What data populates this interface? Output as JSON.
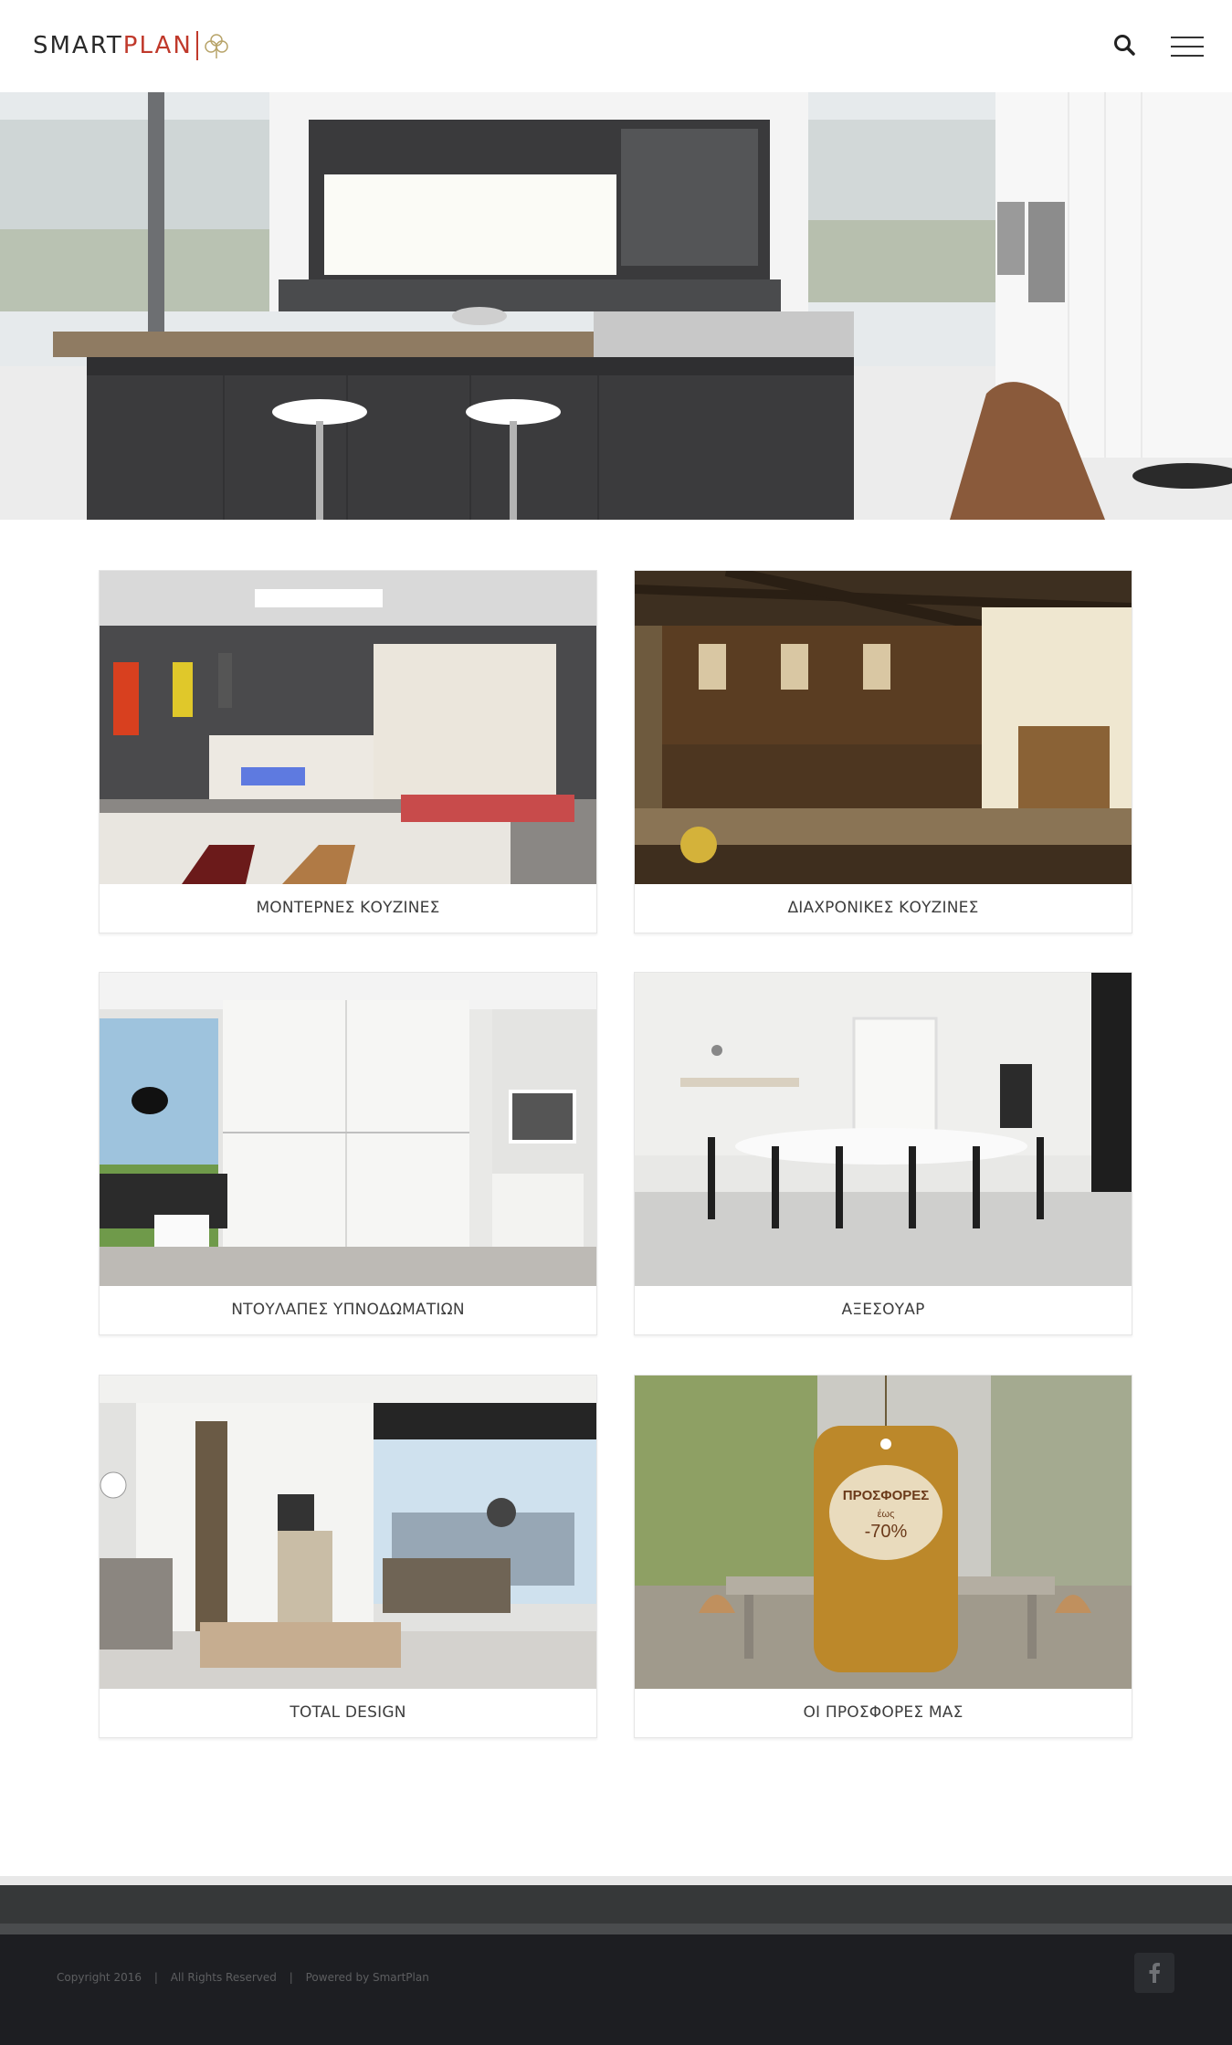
{
  "header": {
    "logo_smart": "SMART",
    "logo_plan": "PLAN",
    "search_icon": "search-icon",
    "menu_icon": "hamburger-menu-icon"
  },
  "hero": {
    "slides": 3,
    "active_slide": 2
  },
  "categories": [
    {
      "label": "ΜΟΝΤΕΡΝΕΣ ΚΟΥΖΙΝΕΣ"
    },
    {
      "label": "ΔΙΑΧΡΟΝΙΚΕΣ ΚΟΥΖΙΝΕΣ"
    },
    {
      "label": "ΝΤΟΥΛΑΠΕΣ ΥΠΝΟΔΩΜΑΤΙΩΝ"
    },
    {
      "label": "ΑΞΕΣΟΥΑΡ"
    },
    {
      "label": "TOTAL DESIGN"
    },
    {
      "label": "ΟΙ ΠΡΟΣΦΟΡΕΣ ΜΑΣ"
    }
  ],
  "promo": {
    "title": "ΠΡΟΣΦΟΡΕΣ",
    "upto": "έως",
    "discount": "-70%"
  },
  "footer": {
    "copyright": "Copyright 2016",
    "rights": "All Rights Reserved",
    "powered": "Powered by SmartPlan",
    "separator": "|",
    "social_icon": "facebook-icon"
  },
  "colors": {
    "brand_red": "#c0392b",
    "footer_dark": "#1d1e22",
    "footer_mid": "#363839"
  }
}
